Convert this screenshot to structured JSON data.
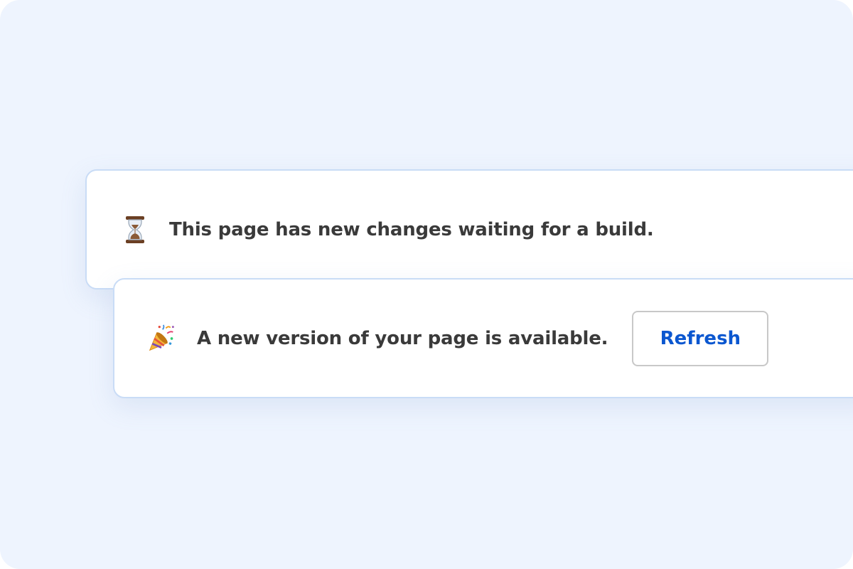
{
  "notifications": {
    "building": {
      "icon": "hourglass-icon",
      "message": "This page has new changes waiting for a build."
    },
    "update": {
      "icon": "party-popper-icon",
      "message": "A new version of your page is available.",
      "action_label": "Refresh"
    }
  },
  "colors": {
    "background": "#eef4fe",
    "card": "#ffffff",
    "card_border": "#c9dcf6",
    "text": "#3a3a3a",
    "accent": "#0b57d0",
    "button_border": "#c8c8c8"
  }
}
